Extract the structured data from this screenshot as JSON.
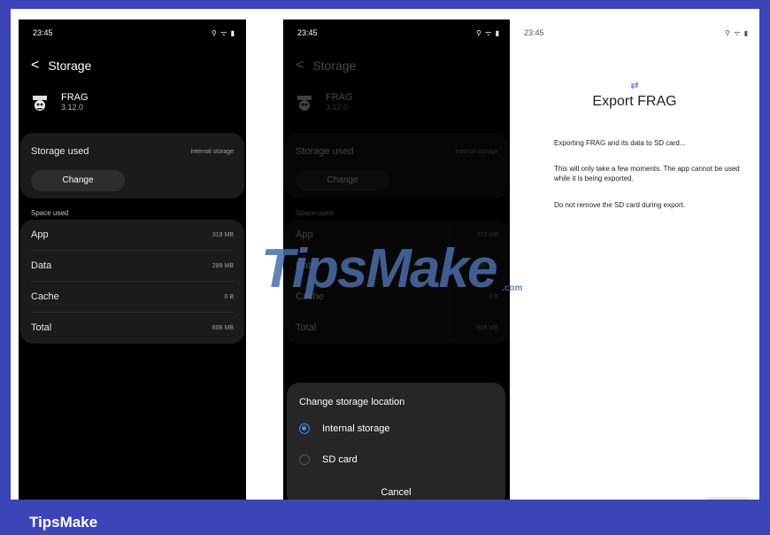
{
  "phone1": {
    "status": {
      "time": "23:45",
      "icons": "⚲ ᯤ ▮"
    },
    "header": {
      "back": "<",
      "title": "Storage"
    },
    "app": {
      "name": "FRAG",
      "version": "3.12.0"
    },
    "storage": {
      "label": "Storage used",
      "value": "Internal storage",
      "change": "Change"
    },
    "space_label": "Space used",
    "rows": [
      {
        "label": "App",
        "value": "319 MB"
      },
      {
        "label": "Data",
        "value": "289 MB"
      },
      {
        "label": "Cache",
        "value": "0 B"
      },
      {
        "label": "Total",
        "value": "608 MB"
      }
    ]
  },
  "phone2": {
    "status": {
      "time": "23:45",
      "icons": "⚲ ᯤ ▮"
    },
    "header": {
      "back": "<",
      "title": "Storage"
    },
    "app": {
      "name": "FRAG",
      "version": "3.12.0"
    },
    "storage": {
      "label": "Storage used",
      "value": "Internal storage",
      "change": "Change"
    },
    "space_label": "Space used",
    "rows": [
      {
        "label": "App",
        "value": "319 MB"
      },
      {
        "label": "Data",
        "value": "289 MB"
      },
      {
        "label": "Cache",
        "value": "0 B"
      },
      {
        "label": "Total",
        "value": "608 MB"
      }
    ],
    "dialog": {
      "title": "Change storage location",
      "options": [
        {
          "label": "Internal storage",
          "selected": true
        },
        {
          "label": "SD card",
          "selected": false
        }
      ],
      "cancel": "Cancel"
    }
  },
  "phone3": {
    "status": {
      "time": "23:45",
      "icons": "⚲ ᯤ ▮"
    },
    "icon": "⇄",
    "title": "Export FRAG",
    "messages": [
      "Exporting FRAG and its data to SD card...",
      "This will only take a few moments. The app cannot be used while it is being exported.",
      "Do not remove the SD card during export."
    ]
  },
  "watermark": {
    "text": "TipsMake",
    "suffix": ".com"
  },
  "footer": {
    "brand": "TipsMake"
  },
  "colors": {
    "frame": "#3b44b8",
    "accent": "#3e8df5",
    "card": "#1b1b1d"
  }
}
